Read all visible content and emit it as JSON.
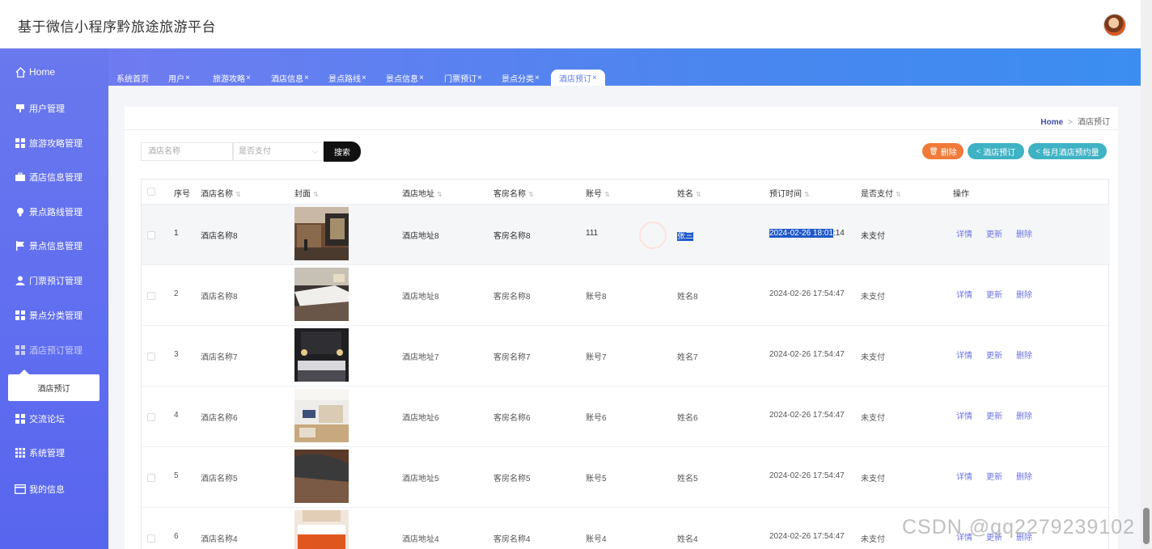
{
  "app": {
    "title": "基于微信小程序黔旅途旅游平台"
  },
  "sidebar": {
    "home": "Home",
    "items": [
      {
        "label": "用户管理",
        "icon": "monitor-icon"
      },
      {
        "label": "旅游攻略管理",
        "icon": "grid-icon"
      },
      {
        "label": "酒店信息管理",
        "icon": "briefcase-icon"
      },
      {
        "label": "景点路线管理",
        "icon": "bulb-icon"
      },
      {
        "label": "景点信息管理",
        "icon": "flag-icon"
      },
      {
        "label": "门票预订管理",
        "icon": "user-icon"
      },
      {
        "label": "景点分类管理",
        "icon": "grid-icon"
      },
      {
        "label": "酒店预订管理",
        "icon": "grid-icon"
      },
      {
        "label": "交流论坛",
        "icon": "grid-icon"
      },
      {
        "label": "系统管理",
        "icon": "apps-icon"
      },
      {
        "label": "我的信息",
        "icon": "card-icon"
      }
    ],
    "submenu": "酒店预订"
  },
  "tabs": [
    {
      "label": "系统首页",
      "close": ""
    },
    {
      "label": "用户",
      "close": "×"
    },
    {
      "label": "旅游攻略",
      "close": "×"
    },
    {
      "label": "酒店信息",
      "close": "×"
    },
    {
      "label": "景点路线",
      "close": "×"
    },
    {
      "label": "景点信息",
      "close": "×"
    },
    {
      "label": "门票预订",
      "close": "×"
    },
    {
      "label": "景点分类",
      "close": "×"
    },
    {
      "label": "酒店预订",
      "close": "×"
    }
  ],
  "breadcrumb": {
    "home": "Home",
    "sep": ">",
    "current": "酒店预订"
  },
  "search": {
    "name_placeholder": "酒店名称",
    "pay_placeholder": "是否支付",
    "button": "搜索"
  },
  "actions": {
    "delete": "删除",
    "book": "酒店预订",
    "monthly": "每月酒店预约量"
  },
  "table": {
    "headers": [
      "序号",
      "酒店名称",
      "封面",
      "酒店地址",
      "客房名称",
      "账号",
      "姓名",
      "预订时间",
      "是否支付",
      "操作"
    ],
    "ops": [
      "详情",
      "更新",
      "删除"
    ],
    "rows": [
      {
        "no": "1",
        "hotel": "酒店名称8",
        "addr": "酒店地址8",
        "room": "客房名称8",
        "account": "111",
        "name": "张三",
        "time_sel": "2024-02-26 18:01",
        "time_rest": ":14",
        "paid": "未支付"
      },
      {
        "no": "2",
        "hotel": "酒店名称8",
        "addr": "酒店地址8",
        "room": "客房名称8",
        "account": "账号8",
        "name": "姓名8",
        "time": "2024-02-26 17:54:47",
        "paid": "未支付"
      },
      {
        "no": "3",
        "hotel": "酒店名称7",
        "addr": "酒店地址7",
        "room": "客房名称7",
        "account": "账号7",
        "name": "姓名7",
        "time": "2024-02-26 17:54:47",
        "paid": "未支付"
      },
      {
        "no": "4",
        "hotel": "酒店名称6",
        "addr": "酒店地址6",
        "room": "客房名称6",
        "account": "账号6",
        "name": "姓名6",
        "time": "2024-02-26 17:54:47",
        "paid": "未支付"
      },
      {
        "no": "5",
        "hotel": "酒店名称5",
        "addr": "酒店地址5",
        "room": "客房名称5",
        "account": "账号5",
        "name": "姓名5",
        "time": "2024-02-26 17:54:47",
        "paid": "未支付"
      },
      {
        "no": "6",
        "hotel": "酒店名称4",
        "addr": "酒店地址4",
        "room": "客房名称4",
        "account": "账号4",
        "name": "姓名4",
        "time": "2024-02-26 17:54:47",
        "paid": "未支付"
      }
    ]
  },
  "watermark": "CSDN @qq2279239102",
  "colors": {
    "sidebar": "#5f6df0",
    "accent": "#6b72e6",
    "delete": "#f07a3a",
    "teal": "#3fb2c4"
  }
}
